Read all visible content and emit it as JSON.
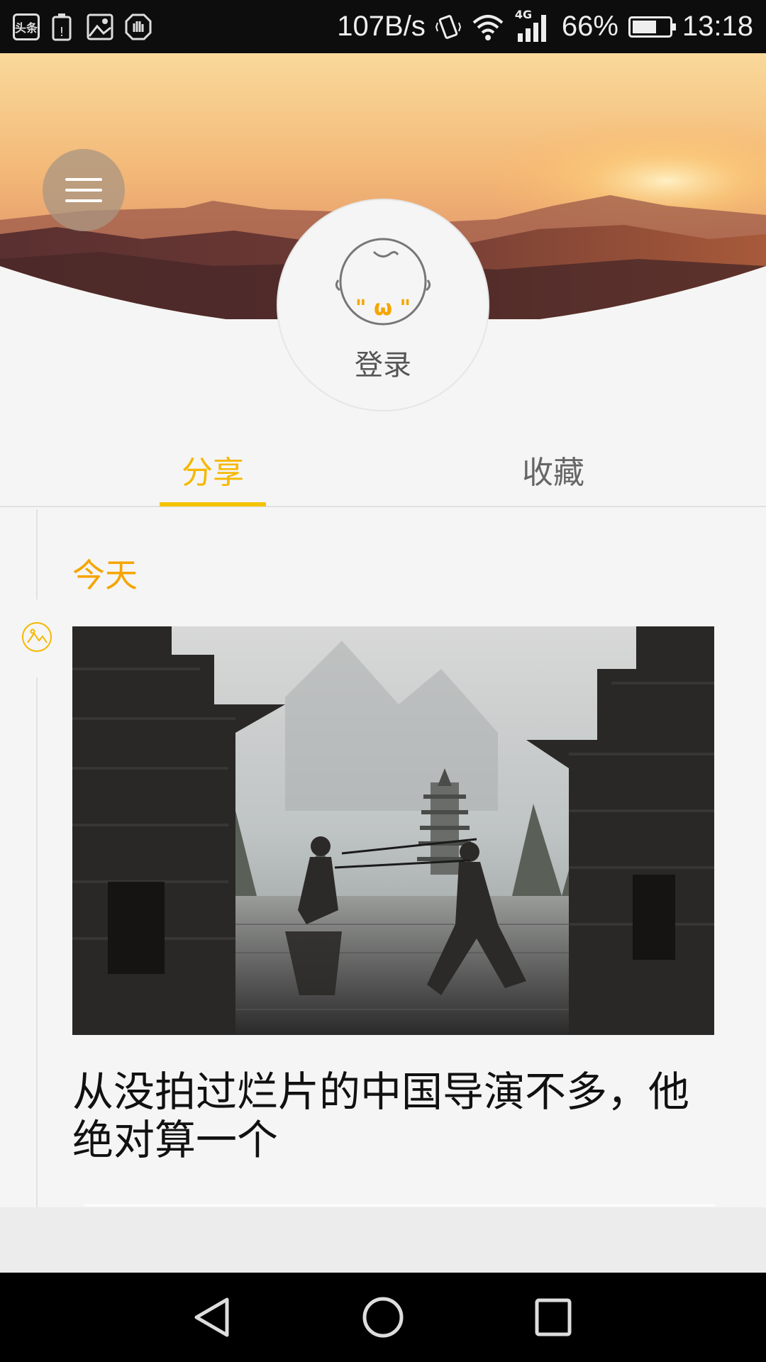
{
  "status_bar": {
    "notif_icon_1_text": "头条",
    "speed": "107B/s",
    "network_type": "4G",
    "battery_percent": "66%",
    "battery_level": 0.66,
    "time": "13:18"
  },
  "profile": {
    "login_label": "登录",
    "avatar_face_text": "\" ω \""
  },
  "tabs": [
    {
      "label": "分享",
      "active": true
    },
    {
      "label": "收藏",
      "active": false
    }
  ],
  "feed": {
    "date_label": "今天",
    "article_title": "从没拍过烂片的中国导演不多，他绝对算一个"
  },
  "colors": {
    "accent": "#f5b800",
    "date_orange": "#f5a500",
    "tab_indicator": "#f5c400"
  }
}
